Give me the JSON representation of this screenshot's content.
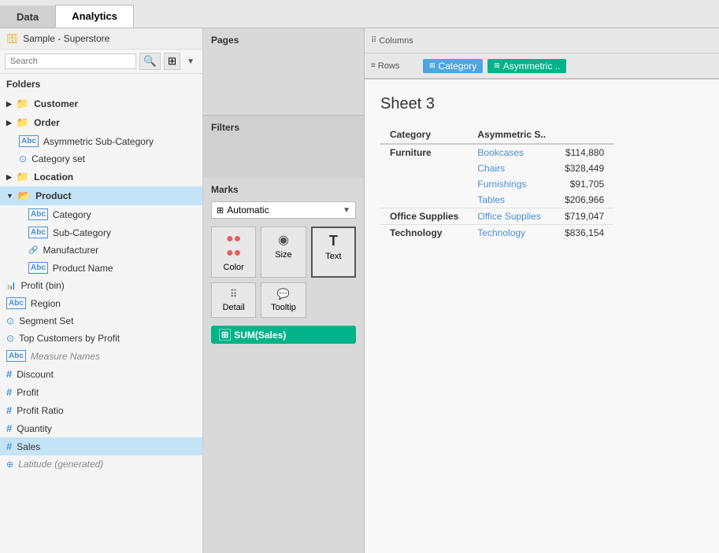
{
  "tabs": {
    "data_label": "Data",
    "analytics_label": "Analytics"
  },
  "left_panel": {
    "data_source": "Sample - Superstore",
    "search_placeholder": "Search",
    "folders_label": "Folders",
    "items": [
      {
        "id": "customer",
        "label": "Customer",
        "type": "folder",
        "indent": 0
      },
      {
        "id": "order",
        "label": "Order",
        "type": "folder",
        "indent": 0
      },
      {
        "id": "asymmetric",
        "label": "Asymmetric Sub-Category",
        "type": "abc",
        "indent": 1
      },
      {
        "id": "category-set",
        "label": "Category set",
        "type": "set",
        "indent": 1
      },
      {
        "id": "location",
        "label": "Location",
        "type": "folder",
        "indent": 0
      },
      {
        "id": "product",
        "label": "Product",
        "type": "folder-open",
        "indent": 0,
        "selected": true
      },
      {
        "id": "category",
        "label": "Category",
        "type": "abc",
        "indent": 2
      },
      {
        "id": "sub-category",
        "label": "Sub-Category",
        "type": "abc",
        "indent": 2
      },
      {
        "id": "manufacturer",
        "label": "Manufacturer",
        "type": "link",
        "indent": 2
      },
      {
        "id": "product-name",
        "label": "Product Name",
        "type": "abc",
        "indent": 2
      },
      {
        "id": "profit-bin",
        "label": "Profit (bin)",
        "type": "bar",
        "indent": 0
      },
      {
        "id": "region",
        "label": "Region",
        "type": "abc",
        "indent": 0
      },
      {
        "id": "segment-set",
        "label": "Segment Set",
        "type": "set",
        "indent": 0
      },
      {
        "id": "top-customers",
        "label": "Top Customers by Profit",
        "type": "set",
        "indent": 0
      },
      {
        "id": "measure-names",
        "label": "Measure Names",
        "type": "abc-italic",
        "indent": 0
      },
      {
        "id": "discount",
        "label": "Discount",
        "type": "hash",
        "indent": 0
      },
      {
        "id": "profit",
        "label": "Profit",
        "type": "hash",
        "indent": 0
      },
      {
        "id": "profit-ratio",
        "label": "Profit Ratio",
        "type": "hash",
        "indent": 0
      },
      {
        "id": "quantity",
        "label": "Quantity",
        "type": "hash",
        "indent": 0
      },
      {
        "id": "sales",
        "label": "Sales",
        "type": "hash",
        "indent": 0,
        "selected": true
      },
      {
        "id": "latitude",
        "label": "Latitude (generated)",
        "type": "geo-italic",
        "indent": 0
      }
    ]
  },
  "center_panel": {
    "pages_label": "Pages",
    "filters_label": "Filters",
    "marks_label": "Marks",
    "marks_type": "Automatic",
    "buttons": [
      {
        "id": "color",
        "label": "Color",
        "icon": "●●●●"
      },
      {
        "id": "size",
        "label": "Size",
        "icon": "◉"
      },
      {
        "id": "text",
        "label": "Text",
        "icon": "T"
      },
      {
        "id": "detail",
        "label": "Detail",
        "icon": "●●●"
      },
      {
        "id": "tooltip",
        "label": "Tooltip",
        "icon": "💬"
      }
    ],
    "sum_sales_label": "SUM(Sales)"
  },
  "right_panel": {
    "columns_label": "Columns",
    "rows_label": "Rows",
    "rows_pills": [
      {
        "id": "category-pill",
        "label": "Category",
        "color": "blue"
      },
      {
        "id": "asymmetric-pill",
        "label": "Asymmetric ..",
        "color": "teal"
      }
    ],
    "sheet_title": "Sheet 3",
    "table": {
      "headers": [
        "Category",
        "Asymmetric S.."
      ],
      "rows": [
        {
          "category": "Furniture",
          "sub_rows": [
            {
              "sub_cat": "Bookcases",
              "value": "$114,880"
            },
            {
              "sub_cat": "Chairs",
              "value": "$328,449"
            },
            {
              "sub_cat": "Furnishings",
              "value": "$91,705"
            },
            {
              "sub_cat": "Tables",
              "value": "$206,966"
            }
          ]
        },
        {
          "category": "Office Supplies",
          "sub_rows": [
            {
              "sub_cat": "Office Supplies",
              "value": "$719,047"
            }
          ]
        },
        {
          "category": "Technology",
          "sub_rows": [
            {
              "sub_cat": "Technology",
              "value": "$836,154"
            }
          ]
        }
      ]
    }
  }
}
